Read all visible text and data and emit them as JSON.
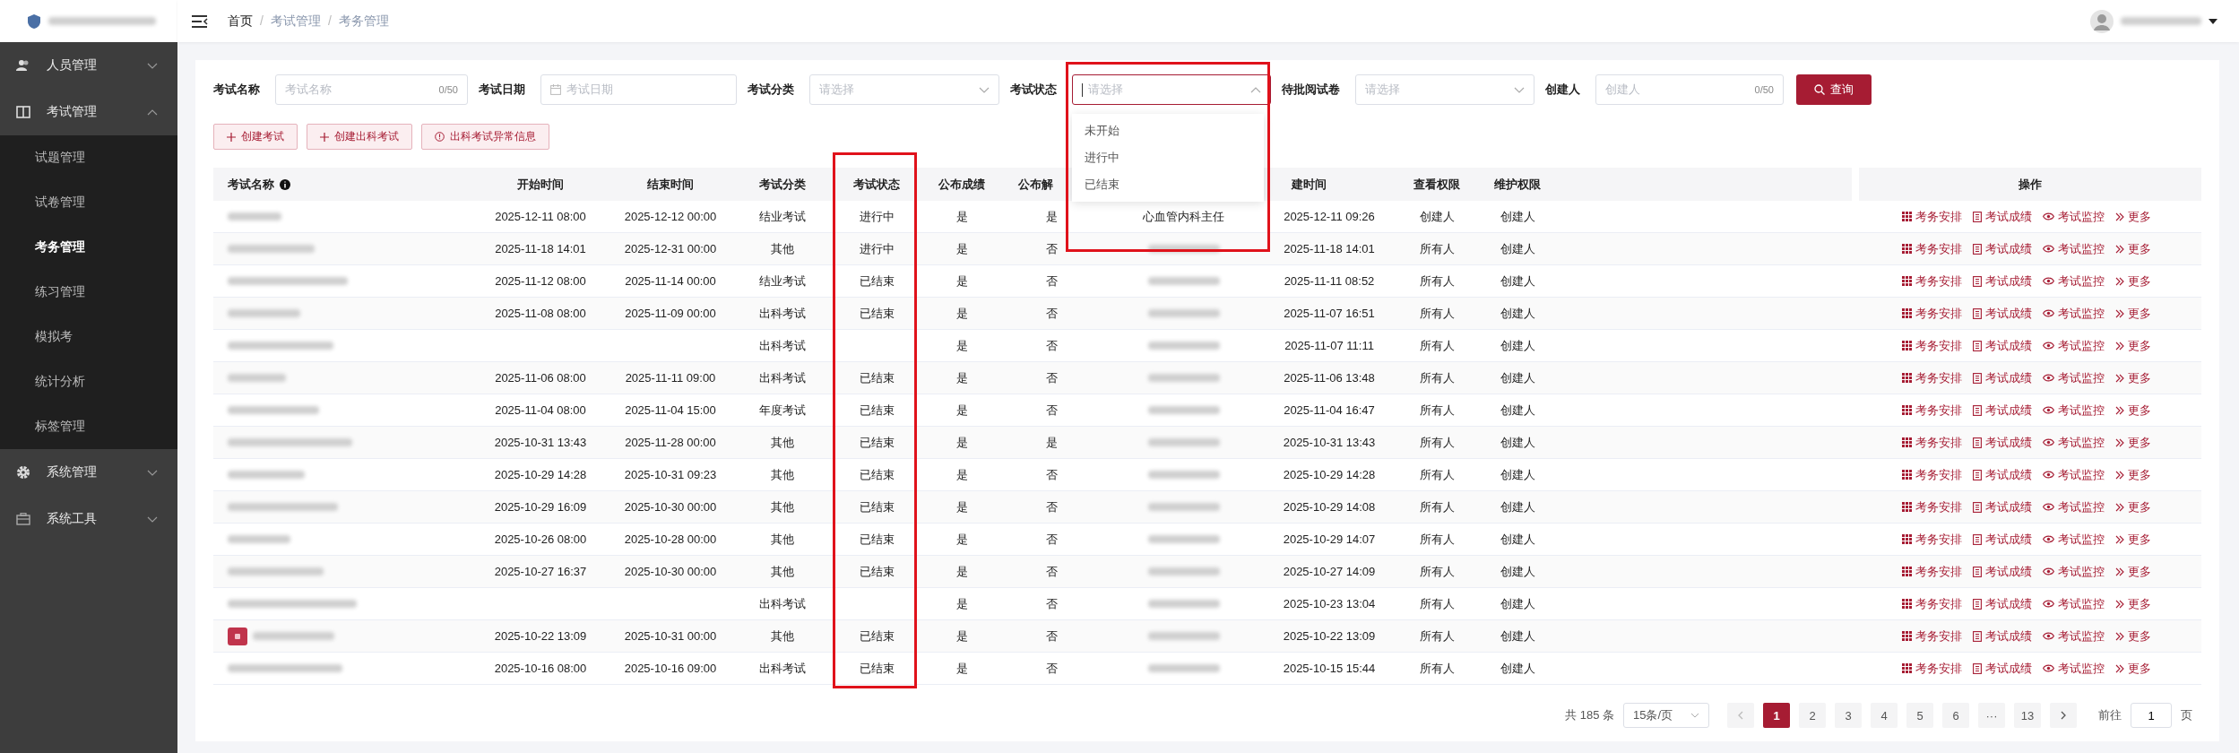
{
  "breadcrumb": {
    "items": [
      "首页",
      "考试管理",
      "考务管理"
    ],
    "separator": "/"
  },
  "sidebar": [
    {
      "label": "人员管理",
      "expanded": false
    },
    {
      "label": "考试管理",
      "expanded": true,
      "children": [
        {
          "label": "试题管理",
          "selected": false
        },
        {
          "label": "试卷管理",
          "selected": false
        },
        {
          "label": "考务管理",
          "selected": true
        },
        {
          "label": "练习管理",
          "selected": false
        },
        {
          "label": "模拟考",
          "selected": false
        },
        {
          "label": "统计分析",
          "selected": false
        },
        {
          "label": "标签管理",
          "selected": false
        }
      ]
    },
    {
      "label": "系统管理",
      "expanded": false
    },
    {
      "label": "系统工具",
      "expanded": false
    }
  ],
  "filters": [
    {
      "label": "考试名称",
      "kind": "text",
      "placeholder": "考试名称",
      "counter": "0/50"
    },
    {
      "label": "考试日期",
      "kind": "date",
      "placeholder": "考试日期"
    },
    {
      "label": "考试分类",
      "kind": "select",
      "placeholder": "请选择",
      "open": false
    },
    {
      "label": "考试状态",
      "kind": "select",
      "placeholder": "请选择",
      "open": true,
      "highlighted": true,
      "options": [
        "未开始",
        "进行中",
        "已结束"
      ]
    },
    {
      "label": "待批阅试卷",
      "kind": "select",
      "placeholder": "请选择",
      "open": false
    },
    {
      "label": "创建人",
      "kind": "text",
      "placeholder": "创建人",
      "counter": "0/50"
    }
  ],
  "search_button": "查询",
  "action_buttons": [
    "创建考试",
    "创建出科考试",
    "出科考试异常信息"
  ],
  "table": {
    "columns": [
      "考试名称",
      "开始时间",
      "结束时间",
      "考试分类",
      "考试状态",
      "公布成绩",
      "公布解",
      "建时间",
      "查看权限",
      "维护权限"
    ],
    "operations_column": "操作",
    "status_column_highlighted": true,
    "rows": [
      {
        "marked": false,
        "start": "2025-12-11 08:00",
        "end": "2025-12-12 00:00",
        "category": "结业考试",
        "status": "进行中",
        "scores": "是",
        "analysis": "是",
        "creator": "心血管内科主任",
        "created": "2025-12-11 09:26",
        "view": "创建人",
        "maintain": "创建人",
        "actions": [
          "考务安排",
          "考试成绩",
          "考试监控",
          "更多"
        ]
      },
      {
        "marked": false,
        "start": "2025-11-18 14:01",
        "end": "2025-12-31 00:00",
        "category": "其他",
        "status": "进行中",
        "scores": "是",
        "analysis": "否",
        "created": "2025-11-18 14:01",
        "view": "所有人",
        "maintain": "创建人",
        "actions": [
          "考务安排",
          "考试成绩",
          "考试监控",
          "更多"
        ]
      },
      {
        "marked": false,
        "start": "2025-11-12 08:00",
        "end": "2025-11-14 00:00",
        "category": "结业考试",
        "status": "已结束",
        "scores": "是",
        "analysis": "否",
        "created": "2025-11-11 08:52",
        "view": "所有人",
        "maintain": "创建人",
        "actions": [
          "考务安排",
          "考试成绩",
          "考试监控",
          "更多"
        ]
      },
      {
        "marked": false,
        "start": "2025-11-08 08:00",
        "end": "2025-11-09 00:00",
        "category": "出科考试",
        "status": "已结束",
        "scores": "是",
        "analysis": "否",
        "created": "2025-11-07 16:51",
        "view": "所有人",
        "maintain": "创建人",
        "actions": [
          "考务安排",
          "考试成绩",
          "考试监控",
          "更多"
        ]
      },
      {
        "marked": false,
        "category": "出科考试",
        "scores": "是",
        "analysis": "否",
        "created": "2025-11-07 11:11",
        "view": "所有人",
        "maintain": "创建人",
        "actions": [
          "考务安排",
          "考试成绩",
          "考试监控",
          "更多"
        ]
      },
      {
        "marked": false,
        "start": "2025-11-06 08:00",
        "end": "2025-11-11 09:00",
        "category": "出科考试",
        "status": "已结束",
        "scores": "是",
        "analysis": "否",
        "created": "2025-11-06 13:48",
        "view": "所有人",
        "maintain": "创建人",
        "actions": [
          "考务安排",
          "考试成绩",
          "考试监控",
          "更多"
        ]
      },
      {
        "marked": false,
        "start": "2025-11-04 08:00",
        "end": "2025-11-04 15:00",
        "category": "年度考试",
        "status": "已结束",
        "scores": "是",
        "analysis": "否",
        "created": "2025-11-04 16:47",
        "view": "所有人",
        "maintain": "创建人",
        "actions": [
          "考务安排",
          "考试成绩",
          "考试监控",
          "更多"
        ]
      },
      {
        "marked": false,
        "start": "2025-10-31 13:43",
        "end": "2025-11-28 00:00",
        "category": "其他",
        "status": "已结束",
        "scores": "是",
        "analysis": "是",
        "created": "2025-10-31 13:43",
        "view": "所有人",
        "maintain": "创建人",
        "actions": [
          "考务安排",
          "考试成绩",
          "考试监控",
          "更多"
        ]
      },
      {
        "marked": false,
        "start": "2025-10-29 14:28",
        "end": "2025-10-31 09:23",
        "category": "其他",
        "status": "已结束",
        "scores": "是",
        "analysis": "否",
        "created": "2025-10-29 14:28",
        "view": "所有人",
        "maintain": "创建人",
        "actions": [
          "考务安排",
          "考试成绩",
          "考试监控",
          "更多"
        ]
      },
      {
        "marked": false,
        "start": "2025-10-29 16:09",
        "end": "2025-10-30 00:00",
        "category": "其他",
        "status": "已结束",
        "scores": "是",
        "analysis": "否",
        "created": "2025-10-29 14:08",
        "view": "所有人",
        "maintain": "创建人",
        "actions": [
          "考务安排",
          "考试成绩",
          "考试监控",
          "更多"
        ]
      },
      {
        "marked": false,
        "start": "2025-10-26 08:00",
        "end": "2025-10-28 00:00",
        "category": "其他",
        "status": "已结束",
        "scores": "是",
        "analysis": "否",
        "created": "2025-10-29 14:07",
        "view": "所有人",
        "maintain": "创建人",
        "actions": [
          "考务安排",
          "考试成绩",
          "考试监控",
          "更多"
        ]
      },
      {
        "marked": false,
        "start": "2025-10-27 16:37",
        "end": "2025-10-30 00:00",
        "category": "其他",
        "status": "已结束",
        "scores": "是",
        "analysis": "否",
        "created": "2025-10-27 14:09",
        "view": "所有人",
        "maintain": "创建人",
        "actions": [
          "考务安排",
          "考试成绩",
          "考试监控",
          "更多"
        ]
      },
      {
        "marked": false,
        "category": "出科考试",
        "scores": "是",
        "analysis": "否",
        "created": "2025-10-23 13:04",
        "view": "所有人",
        "maintain": "创建人",
        "actions": [
          "考务安排",
          "考试成绩",
          "考试监控",
          "更多"
        ]
      },
      {
        "marked": true,
        "start": "2025-10-22 13:09",
        "end": "2025-10-31 00:00",
        "category": "其他",
        "status": "已结束",
        "scores": "是",
        "analysis": "否",
        "created": "2025-10-22 13:09",
        "view": "所有人",
        "maintain": "创建人",
        "actions": [
          "考务安排",
          "考试成绩",
          "考试监控",
          "更多"
        ]
      },
      {
        "marked": false,
        "start": "2025-10-16 08:00",
        "end": "2025-10-16 09:00",
        "category": "出科考试",
        "status": "已结束",
        "scores": "是",
        "analysis": "否",
        "created": "2025-10-15 15:44",
        "view": "所有人",
        "maintain": "创建人",
        "actions": [
          "考务安排",
          "考试成绩",
          "考试监控",
          "更多"
        ]
      }
    ]
  },
  "pagination": {
    "total": "共 185 条",
    "page_size": "15条/页",
    "pages": [
      {
        "label": "1",
        "selected": true
      },
      {
        "label": "2",
        "selected": false
      },
      {
        "label": "3",
        "selected": false
      },
      {
        "label": "4",
        "selected": false
      },
      {
        "label": "5",
        "selected": false
      },
      {
        "label": "6",
        "selected": false
      },
      {
        "label": "···",
        "selected": false
      },
      {
        "label": "13",
        "selected": false
      }
    ],
    "goto_label": "前往",
    "goto_value": "1",
    "goto_unit": "页"
  }
}
